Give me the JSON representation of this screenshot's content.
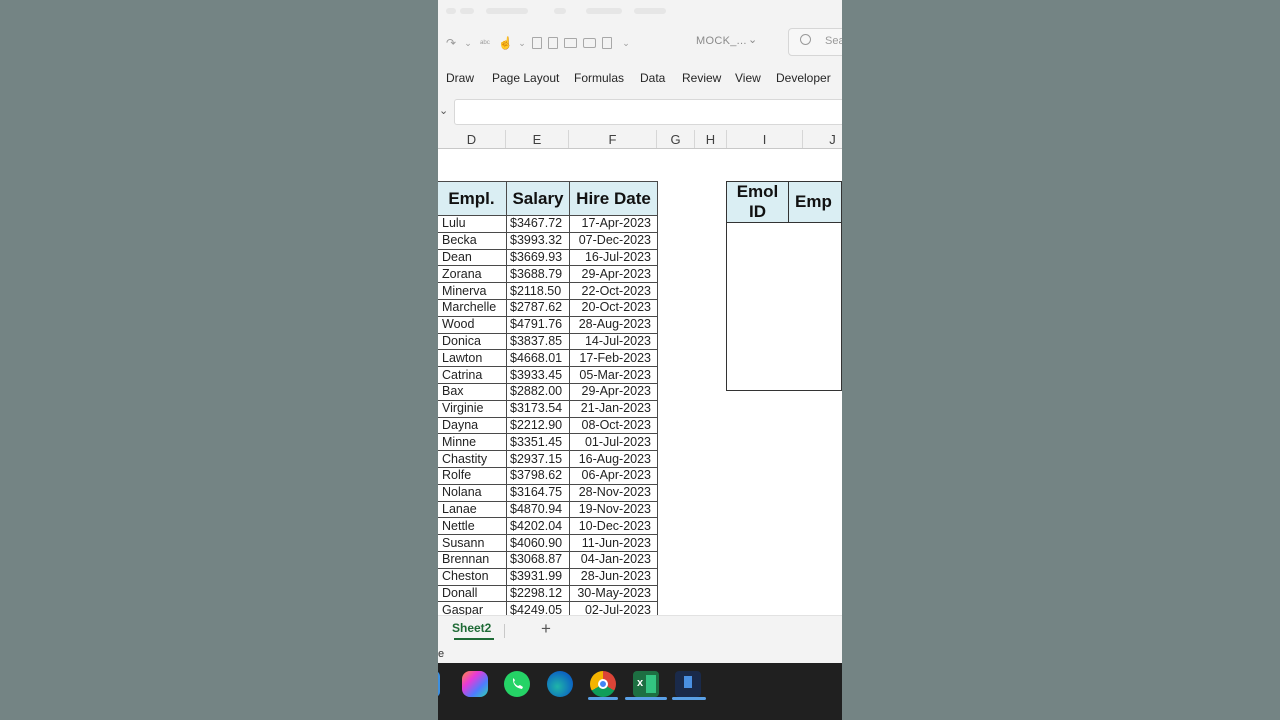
{
  "app": {
    "filename": "MOCK_...",
    "search_placeholder": "Sea"
  },
  "ribbon_tabs": [
    "Draw",
    "Page Layout",
    "Formulas",
    "Data",
    "Review",
    "View",
    "Developer"
  ],
  "columns": [
    "D",
    "E",
    "F",
    "G",
    "H",
    "I",
    "J"
  ],
  "table": {
    "headers": [
      "Empl.",
      "Salary",
      "Hire Date"
    ],
    "rows": [
      [
        "Lulu",
        "$3467.72",
        "17-Apr-2023"
      ],
      [
        "Becka",
        "$3993.32",
        "07-Dec-2023"
      ],
      [
        "Dean",
        "$3669.93",
        "16-Jul-2023"
      ],
      [
        "Zorana",
        "$3688.79",
        "29-Apr-2023"
      ],
      [
        "Minerva",
        "$2118.50",
        "22-Oct-2023"
      ],
      [
        "Marchelle",
        "$2787.62",
        "20-Oct-2023"
      ],
      [
        "Wood",
        "$4791.76",
        "28-Aug-2023"
      ],
      [
        "Donica",
        "$3837.85",
        "14-Jul-2023"
      ],
      [
        "Lawton",
        "$4668.01",
        "17-Feb-2023"
      ],
      [
        "Catrina",
        "$3933.45",
        "05-Mar-2023"
      ],
      [
        "Bax",
        "$2882.00",
        "29-Apr-2023"
      ],
      [
        "Virginie",
        "$3173.54",
        "21-Jan-2023"
      ],
      [
        "Dayna",
        "$2212.90",
        "08-Oct-2023"
      ],
      [
        "Minne",
        "$3351.45",
        "01-Jul-2023"
      ],
      [
        "Chastity",
        "$2937.15",
        "16-Aug-2023"
      ],
      [
        "Rolfe",
        "$3798.62",
        "06-Apr-2023"
      ],
      [
        "Nolana",
        "$3164.75",
        "28-Nov-2023"
      ],
      [
        "Lanae",
        "$4870.94",
        "19-Nov-2023"
      ],
      [
        "Nettle",
        "$4202.04",
        "10-Dec-2023"
      ],
      [
        "Susann",
        "$4060.90",
        "11-Jun-2023"
      ],
      [
        "Brennan",
        "$3068.87",
        "04-Jan-2023"
      ],
      [
        "Cheston",
        "$3931.99",
        "28-Jun-2023"
      ],
      [
        "Donall",
        "$2298.12",
        "30-May-2023"
      ],
      [
        "Gaspar",
        "$4249.05",
        "02-Jul-2023"
      ]
    ]
  },
  "lookup": {
    "headers": [
      "Emol ID",
      "Emp"
    ]
  },
  "sheet_tab": "Sheet2",
  "add_sheet": "+",
  "status_text": "e",
  "colors": {
    "header_fill": "#daeef3",
    "excel_green": "#1f6b36",
    "taskbar": "#202020"
  },
  "taskbar_icons": [
    "start-icon",
    "copilot-icon",
    "whatsapp-icon",
    "edge-icon",
    "chrome-icon",
    "excel-icon",
    "app-icon"
  ]
}
